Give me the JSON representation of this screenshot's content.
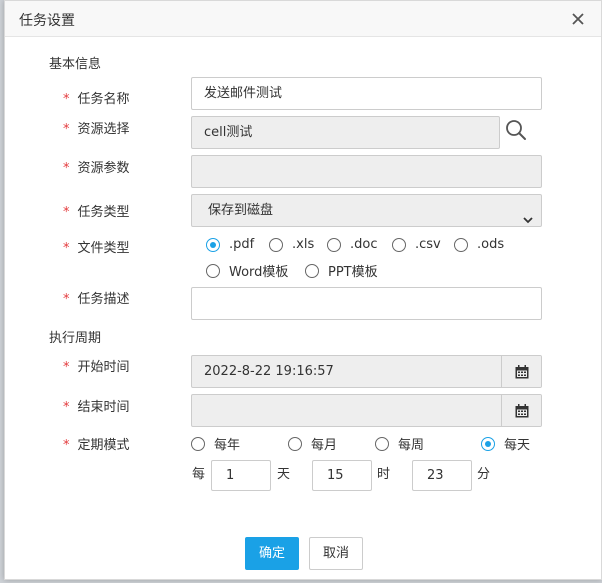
{
  "dialog": {
    "title": "任务设置",
    "close_glyph": "×"
  },
  "sections": {
    "basic": "基本信息",
    "schedule": "执行周期"
  },
  "form": {
    "required_mark": "*",
    "task_name": {
      "label": "任务名称",
      "value": "发送邮件测试"
    },
    "resource": {
      "label": "资源选择",
      "value": "cell测试"
    },
    "resource_params": {
      "label": "资源参数",
      "value": ""
    },
    "task_type": {
      "label": "任务类型",
      "selected": "保存到磁盘"
    },
    "file_type": {
      "label": "文件类型",
      "options": [
        ".pdf",
        ".xls",
        ".doc",
        ".csv",
        ".ods",
        "Word模板",
        "PPT模板"
      ],
      "selected": ".pdf"
    },
    "task_desc": {
      "label": "任务描述",
      "value": ""
    },
    "start_time": {
      "label": "开始时间",
      "value": "2022-8-22 19:16:57"
    },
    "end_time": {
      "label": "结束时间",
      "value": ""
    },
    "period_mode": {
      "label": "定期模式",
      "options": [
        "每年",
        "每月",
        "每周",
        "每天"
      ],
      "selected": "每天"
    },
    "daily": {
      "prefix": "每",
      "day_value": "1",
      "day_unit": "天",
      "hour_value": "15",
      "hour_unit": "时",
      "minute_value": "23",
      "minute_unit": "分"
    }
  },
  "buttons": {
    "confirm": "确定",
    "cancel": "取消"
  },
  "colors": {
    "primary": "#1aa1e6",
    "required": "#e4393c",
    "disabled_bg": "#eeeeee"
  },
  "icons": {
    "close": "close-icon",
    "search": "search-icon",
    "calendar": "calendar-icon",
    "dropdown": "chevron-down-icon"
  }
}
